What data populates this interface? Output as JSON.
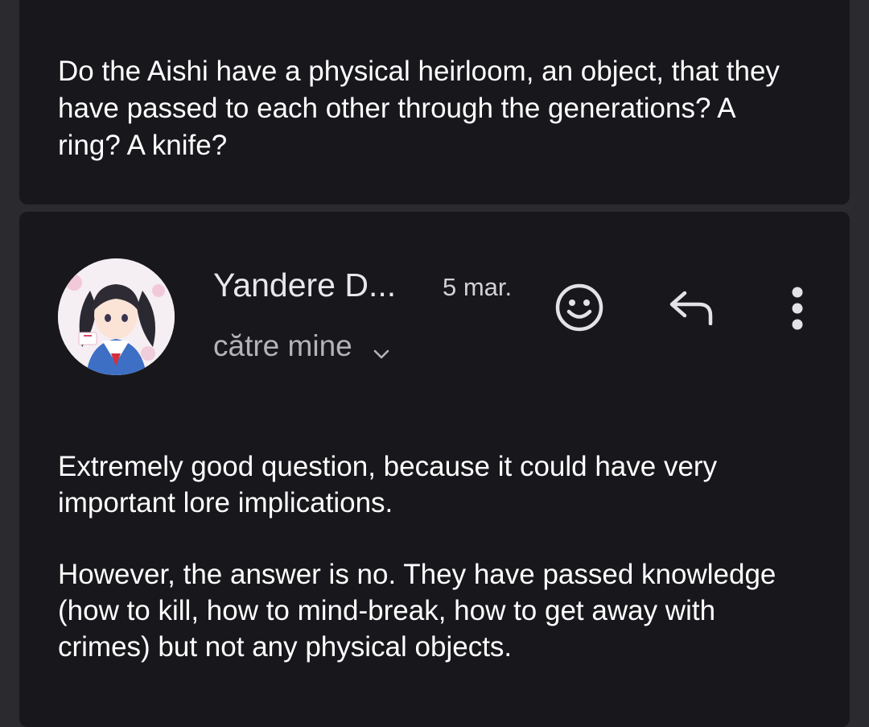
{
  "previous_message": {
    "text": "Do the Aishi have a physical heirloom, an object, that they have passed to each other through the generations? A ring? A knife?"
  },
  "reply_message": {
    "sender": "Yandere D...",
    "date": "5 mar.",
    "recipients_label": "către mine",
    "paragraphs": [
      "Extremely good question, because it could have very important lore implications.",
      "However, the answer is no. They have passed knowledge (how to kill, how to mind-break, how to get away with crimes) but not any physical objects."
    ],
    "icons": {
      "expand": "chevron-down-icon",
      "react": "emoji-smile-icon",
      "reply": "reply-icon",
      "more": "more-vert-icon"
    }
  },
  "colors": {
    "background": "#2b2b2f",
    "card": "#18181c",
    "text_primary": "#ffffff",
    "text_secondary": "#b4b4b8"
  }
}
